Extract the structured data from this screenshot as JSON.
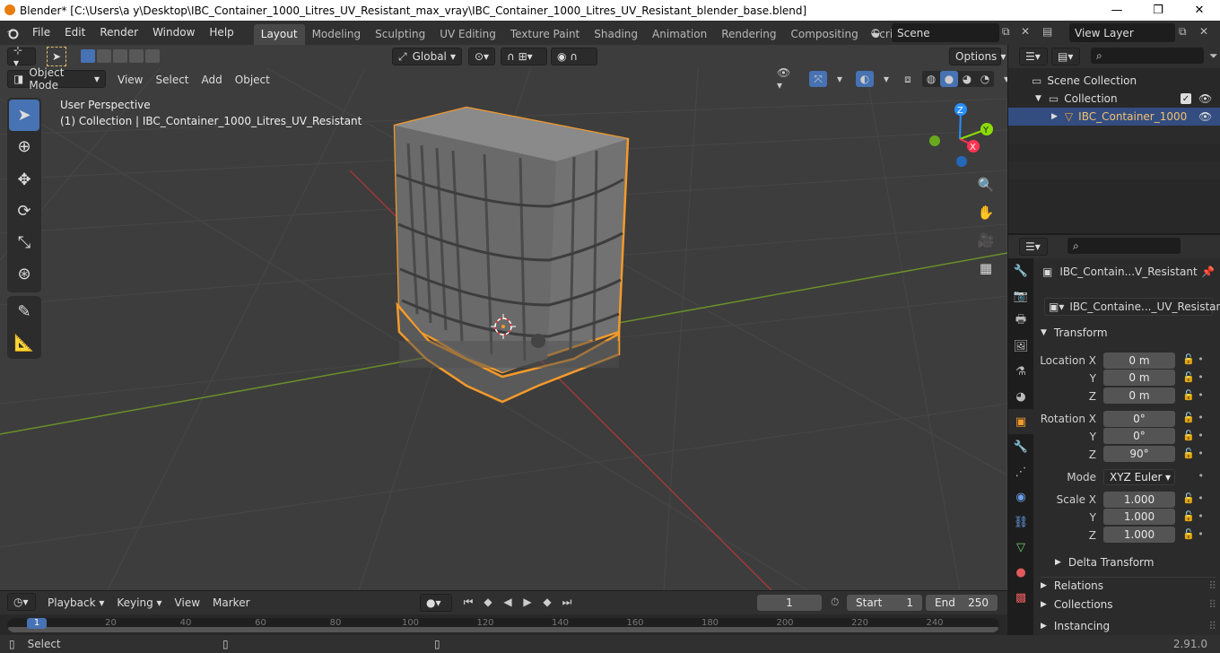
{
  "window": {
    "title": "Blender* [C:\\Users\\a y\\Desktop\\IBC_Container_1000_Litres_UV_Resistant_max_vray\\IBC_Container_1000_Litres_UV_Resistant_blender_base.blend]",
    "minimize": "—",
    "maximize": "❐",
    "close": "✕"
  },
  "menu": [
    "File",
    "Edit",
    "Render",
    "Window",
    "Help"
  ],
  "workspaces": [
    "Layout",
    "Modeling",
    "Sculpting",
    "UV Editing",
    "Texture Paint",
    "Shading",
    "Animation",
    "Rendering",
    "Compositing",
    "Scripting"
  ],
  "workspace_add": "+",
  "scene": {
    "name": "Scene",
    "view_layer": "View Layer"
  },
  "tool_header": {
    "transform_orientation": "Global",
    "options": "Options"
  },
  "viewport_header": {
    "mode": "Object Mode",
    "menus": [
      "View",
      "Select",
      "Add",
      "Object"
    ]
  },
  "viewport": {
    "perspective_label": "User Perspective",
    "collection_label": "(1) Collection | IBC_Container_1000_Litres_UV_Resistant",
    "gizmo": {
      "z": "Z",
      "y": "Y",
      "x": "X"
    }
  },
  "outliner": {
    "rows": [
      {
        "label": "Scene Collection"
      },
      {
        "label": "Collection"
      },
      {
        "label": "IBC_Container_1000"
      }
    ]
  },
  "properties": {
    "object_name": "IBC_Contain...V_Resistant",
    "data_name": "IBC_Containe..._UV_Resistant",
    "transform_label": "Transform",
    "location_label": "Location X",
    "rotation_label": "Rotation X",
    "scale_label": "Scale X",
    "y_label": "Y",
    "z_label": "Z",
    "location": [
      "0 m",
      "0 m",
      "0 m"
    ],
    "rotation": [
      "0°",
      "0°",
      "90°"
    ],
    "mode_label": "Mode",
    "mode_value": "XYZ Euler",
    "scale": [
      "1.000",
      "1.000",
      "1.000"
    ],
    "delta_transform": "Delta Transform",
    "relations": "Relations",
    "collections": "Collections",
    "instancing": "Instancing"
  },
  "timeline": {
    "menus": [
      "Playback",
      "Keying",
      "View",
      "Marker"
    ],
    "current_frame": "1",
    "start_label": "Start",
    "start": "1",
    "end_label": "End",
    "end": "250",
    "ticks": [
      "1",
      "20",
      "40",
      "60",
      "80",
      "100",
      "120",
      "140",
      "160",
      "180",
      "200",
      "220",
      "240"
    ]
  },
  "status": {
    "left": "Select",
    "version": "2.91.0"
  },
  "colors": {
    "accent": "#4772b3",
    "selection_outline": "#f39a2b",
    "x_axis": "#ff3352",
    "y_axis": "#8bdc00",
    "z_axis": "#2890ff"
  }
}
